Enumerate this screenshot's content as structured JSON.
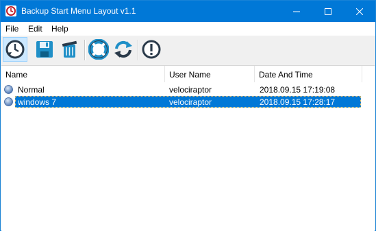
{
  "window": {
    "title": "Backup Start Menu Layout v1.1"
  },
  "menu": {
    "items": [
      "File",
      "Edit",
      "Help"
    ]
  },
  "toolbar": {
    "buttons": [
      {
        "icon": "clock-icon",
        "state": "active"
      },
      {
        "icon": "save-icon"
      },
      {
        "icon": "recycle-bin-icon"
      },
      {
        "icon": "lifebuoy-icon"
      },
      {
        "icon": "refresh-icon"
      },
      {
        "icon": "info-icon"
      }
    ]
  },
  "table": {
    "columns": [
      "Name",
      "User Name",
      "Date And Time"
    ],
    "rows": [
      {
        "name": "Normal",
        "user": "velociraptor",
        "datetime": "2018.09.15 17:19:08",
        "selected": false
      },
      {
        "name": "windows 7",
        "user": "velociraptor",
        "datetime": "2018.09.15 17:28:17",
        "selected": true
      }
    ]
  },
  "colors": {
    "titlebar": "#0078d7",
    "selection": "#0078d7",
    "accent_active": "#cce8ff"
  }
}
